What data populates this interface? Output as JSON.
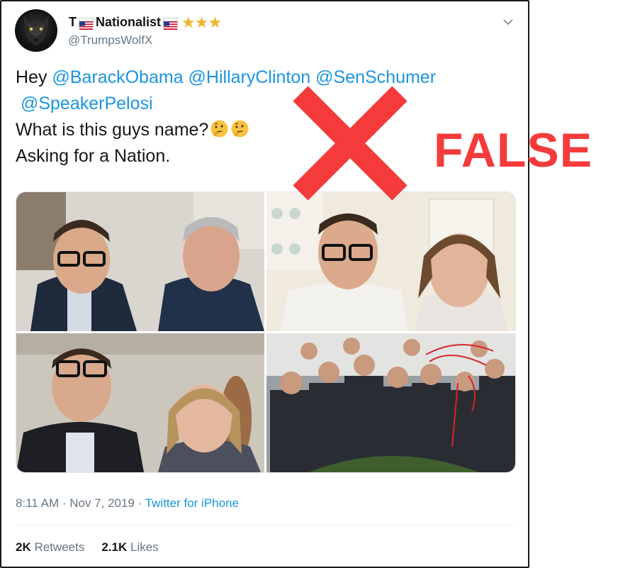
{
  "tweet": {
    "display_name_prefix": "T",
    "display_name_main": "Nationalist",
    "stars": "★★★",
    "handle": "@TrumpsWolfX",
    "text": {
      "line1_prefix": "Hey ",
      "mention1": "@BarackObama",
      "mention2": "@HillaryClinton",
      "mention3": "@SenSchumer",
      "mention4": "@SpeakerPelosi",
      "line3": "What is this guys name?",
      "line4": "Asking for a Nation."
    },
    "timestamp": "8:11 AM · Nov 7, 2019 · ",
    "source": "Twitter for iPhone",
    "retweets_count": "2K",
    "retweets_label": "Retweets",
    "likes_count": "2.1K",
    "likes_label": "Likes"
  },
  "stamp": {
    "verdict": "FALSE",
    "color": "#f53b3b"
  },
  "icons": {
    "flag": "us-flag-icon",
    "menu": "chevron-down-icon",
    "emoji": "thinking-face-icon",
    "verdict_mark": "x-mark-icon"
  },
  "colors": {
    "link": "#1b95e0",
    "muted": "#657786",
    "star": "#f0b42a"
  }
}
